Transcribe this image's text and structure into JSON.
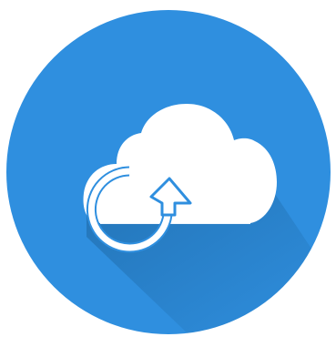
{
  "icon": {
    "name": "cloud-sync-icon",
    "colors": {
      "background": "#ffffff",
      "circle": "#2f8fdf",
      "cloud": "#ffffff",
      "cloud_bottom_tint": "#eef5fc",
      "arrow_stroke": "#2f8fdf",
      "shadow": "#1a5f97"
    }
  }
}
